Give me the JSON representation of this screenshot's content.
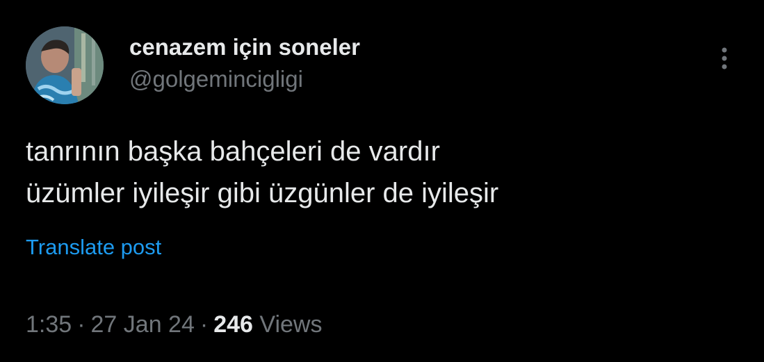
{
  "author": {
    "display_name": "cenazem için soneler",
    "handle": "@golgemincigligi"
  },
  "post": {
    "lines": [
      "tanrının başka bahçeleri de vardır",
      "üzümler iyileşir gibi üzgünler de iyileşir"
    ],
    "translate_label": "Translate post"
  },
  "meta": {
    "time": "1:35",
    "separator": "·",
    "date": "27 Jan 24",
    "views_count": "246",
    "views_label": "Views"
  },
  "icons": {
    "more": "more-vertical-icon",
    "avatar": "avatar-photo"
  },
  "colors": {
    "background": "#000000",
    "primary_text": "#e7e9ea",
    "secondary_text": "#71767b",
    "link": "#1d9bf0"
  }
}
